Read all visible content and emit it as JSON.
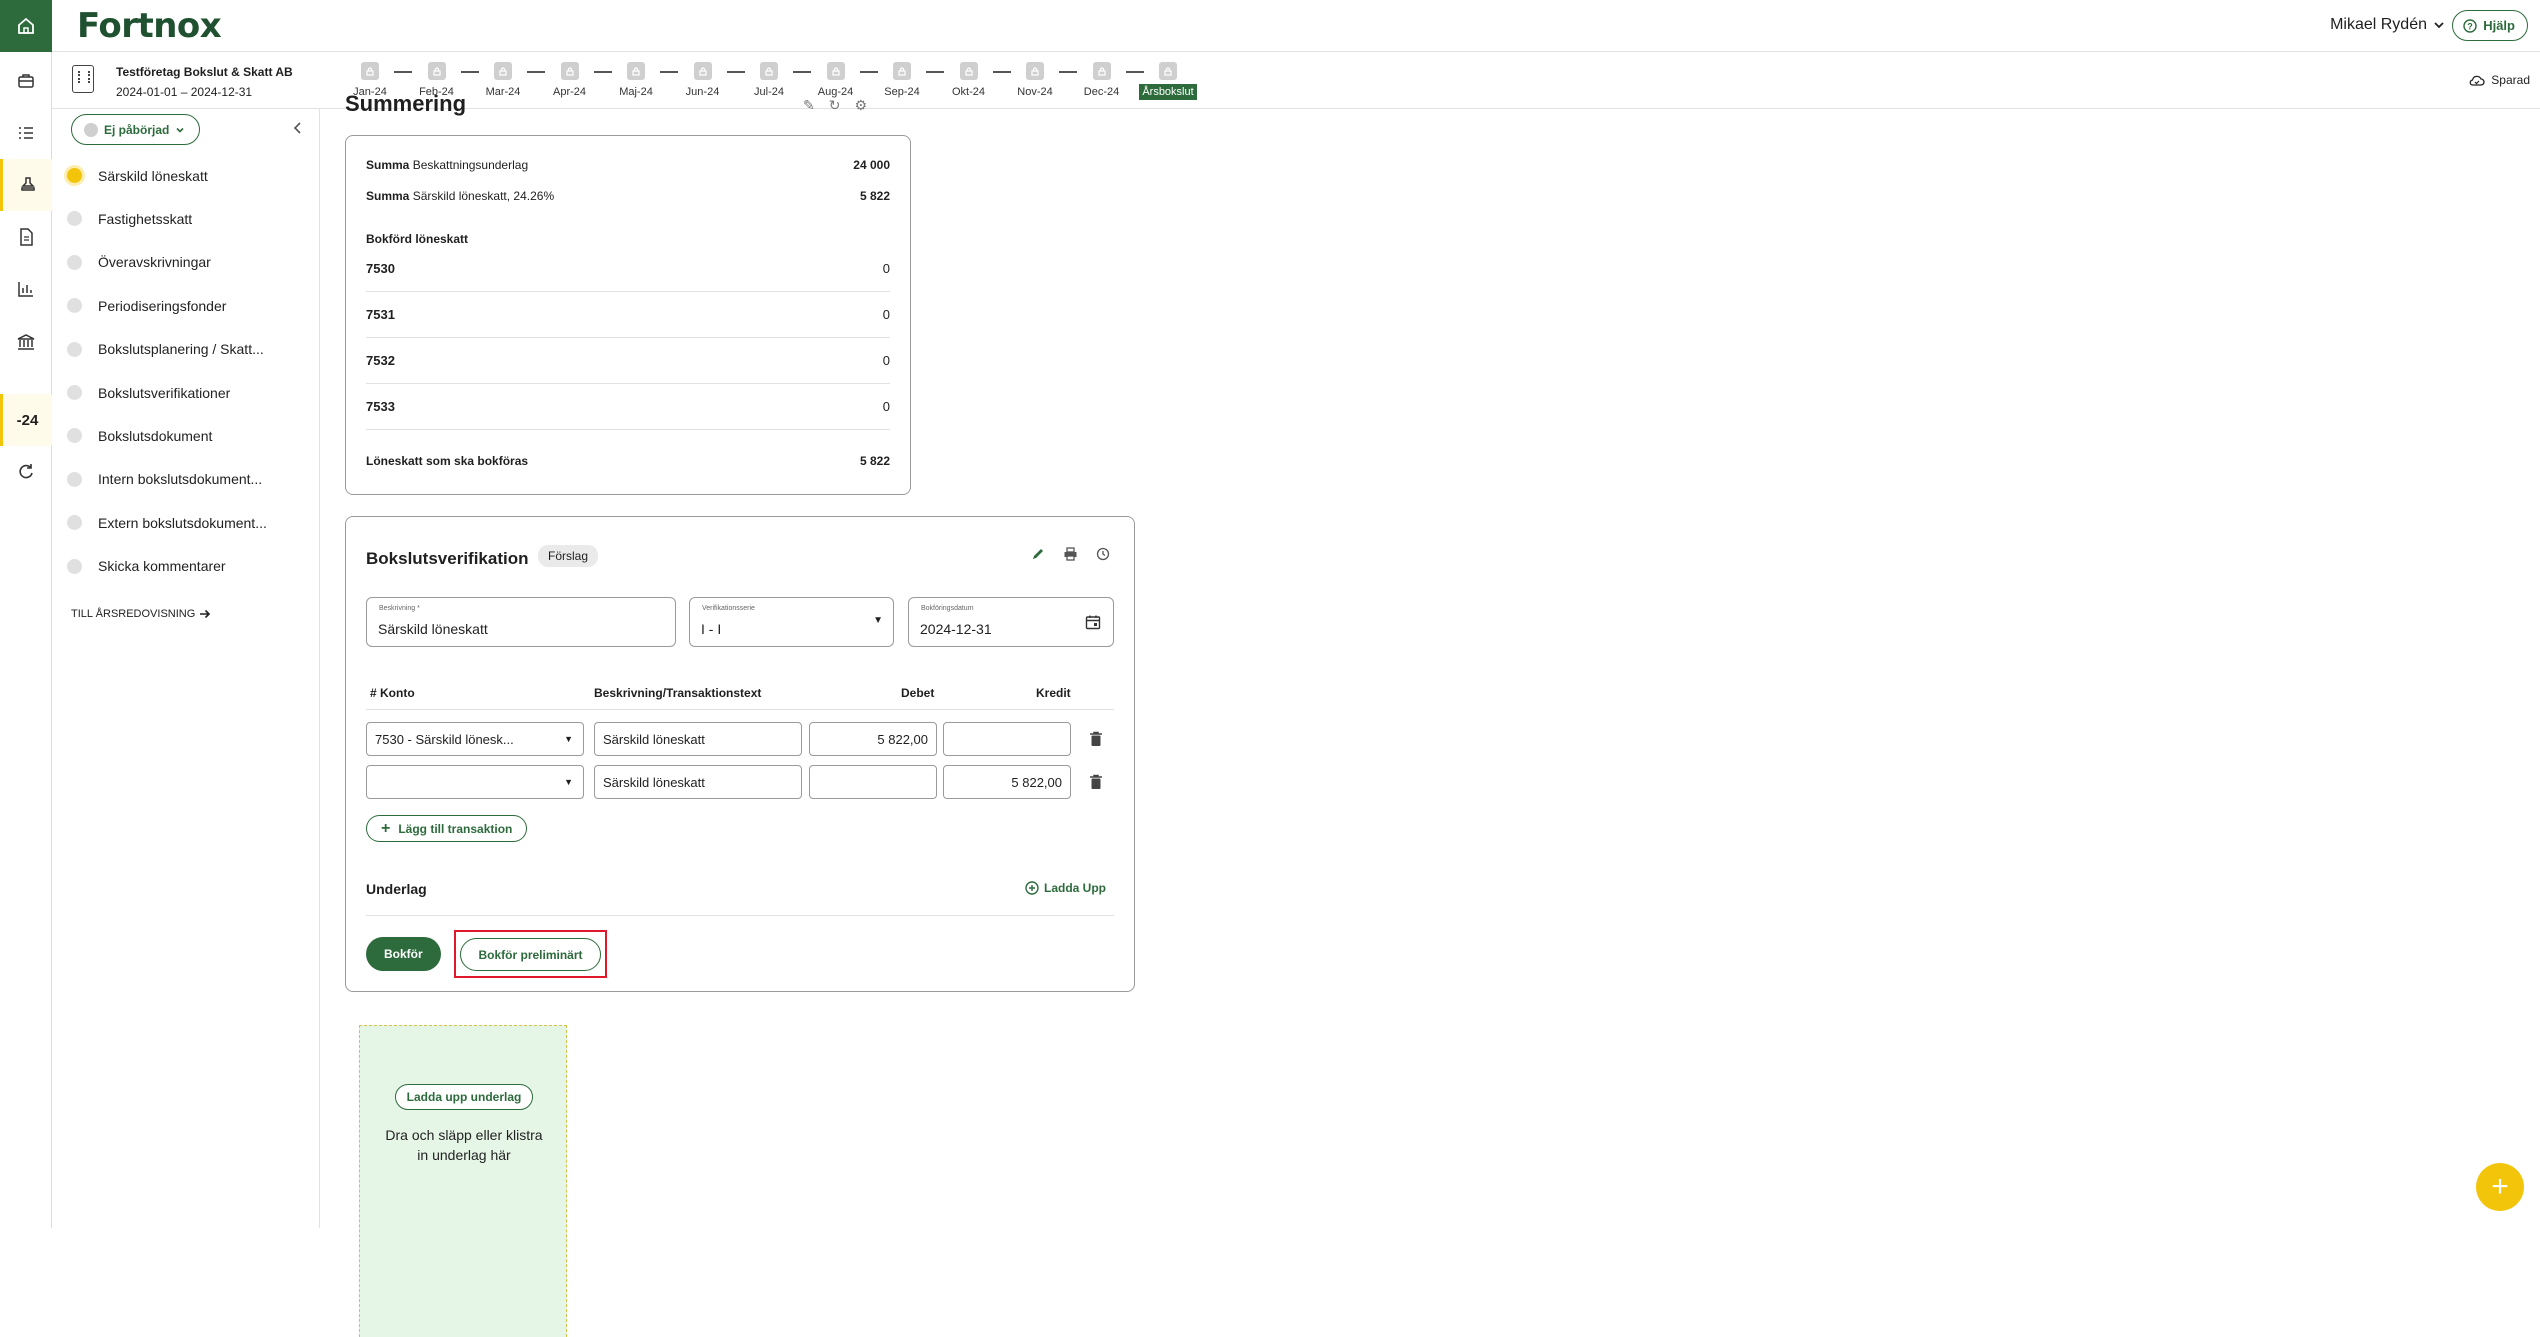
{
  "header": {
    "logo": "Fortnox",
    "user_name": "Mikael Rydén",
    "help_label": "Hjälp"
  },
  "rail": {
    "year_badge": "-24"
  },
  "company": {
    "name": "Testföretag Bokslut & Skatt AB",
    "period": "2024-01-01 – 2024-12-31"
  },
  "timeline": {
    "months": [
      "Jan-24",
      "Feb-24",
      "Mar-24",
      "Apr-24",
      "Maj-24",
      "Jun-24",
      "Jul-24",
      "Aug-24",
      "Sep-24",
      "Okt-24",
      "Nov-24",
      "Dec-24",
      "Årsbokslut"
    ],
    "active_label": "Årsbokslut"
  },
  "saved_label": "Sparad",
  "nav": {
    "status_label": "Ej påbörjad",
    "items": [
      {
        "label": "Särskild löneskatt",
        "current": true
      },
      {
        "label": "Fastighetsskatt"
      },
      {
        "label": "Överavskrivningar"
      },
      {
        "label": "Periodiseringsfonder"
      },
      {
        "label": "Bokslutsplanering / Skatt..."
      },
      {
        "label": "Bokslutsverifikationer"
      },
      {
        "label": "Bokslutsdokument"
      },
      {
        "label": "Intern bokslutsdokument..."
      },
      {
        "label": "Extern bokslutsdokument..."
      },
      {
        "label": "Skicka kommentarer"
      }
    ],
    "to_annual": "TILL ÅRSREDOVISNING"
  },
  "summary": {
    "title": "Summering",
    "rows": [
      {
        "prefix": "Summa",
        "label": "Beskattningsunderlag",
        "value": "24 000"
      },
      {
        "prefix": "Summa",
        "label": "Särskild löneskatt, 24.26%",
        "value": "5 822"
      }
    ],
    "booked_heading": "Bokförd löneskatt",
    "accounts": [
      {
        "account": "7530",
        "value": "0"
      },
      {
        "account": "7531",
        "value": "0"
      },
      {
        "account": "7532",
        "value": "0"
      },
      {
        "account": "7533",
        "value": "0"
      }
    ],
    "total_label": "Löneskatt som ska bokföras",
    "total_value": "5 822"
  },
  "verification": {
    "title": "Bokslutsverifikation",
    "badge": "Förslag",
    "description_label": "Beskrivning *",
    "description_value": "Särskild löneskatt",
    "series_label": "Verifikationsserie",
    "series_value": "I - I",
    "date_label": "Bokföringsdatum",
    "date_value": "2024-12-31",
    "columns": {
      "account": "# Konto",
      "text": "Beskrivning/Transaktionstext",
      "debit": "Debet",
      "credit": "Kredit"
    },
    "rows": [
      {
        "account": "7530 - Särskild lönesk...",
        "text": "Särskild löneskatt",
        "debit": "5 822,00",
        "credit": ""
      },
      {
        "account": "",
        "text": "Särskild löneskatt",
        "debit": "",
        "credit": "5 822,00"
      }
    ],
    "add_transaction": "Lägg till transaktion",
    "attachments_heading": "Underlag",
    "upload_link": "Ladda Upp",
    "post_button": "Bokför",
    "post_prelim_button": "Bokför preliminärt"
  },
  "dropzone": {
    "button": "Ladda upp underlag",
    "text": "Dra och släpp eller klistra in underlag här"
  },
  "colors": {
    "brand": "#2d6b3c",
    "accent": "#f2c50b",
    "highlight": "#e0182b"
  }
}
